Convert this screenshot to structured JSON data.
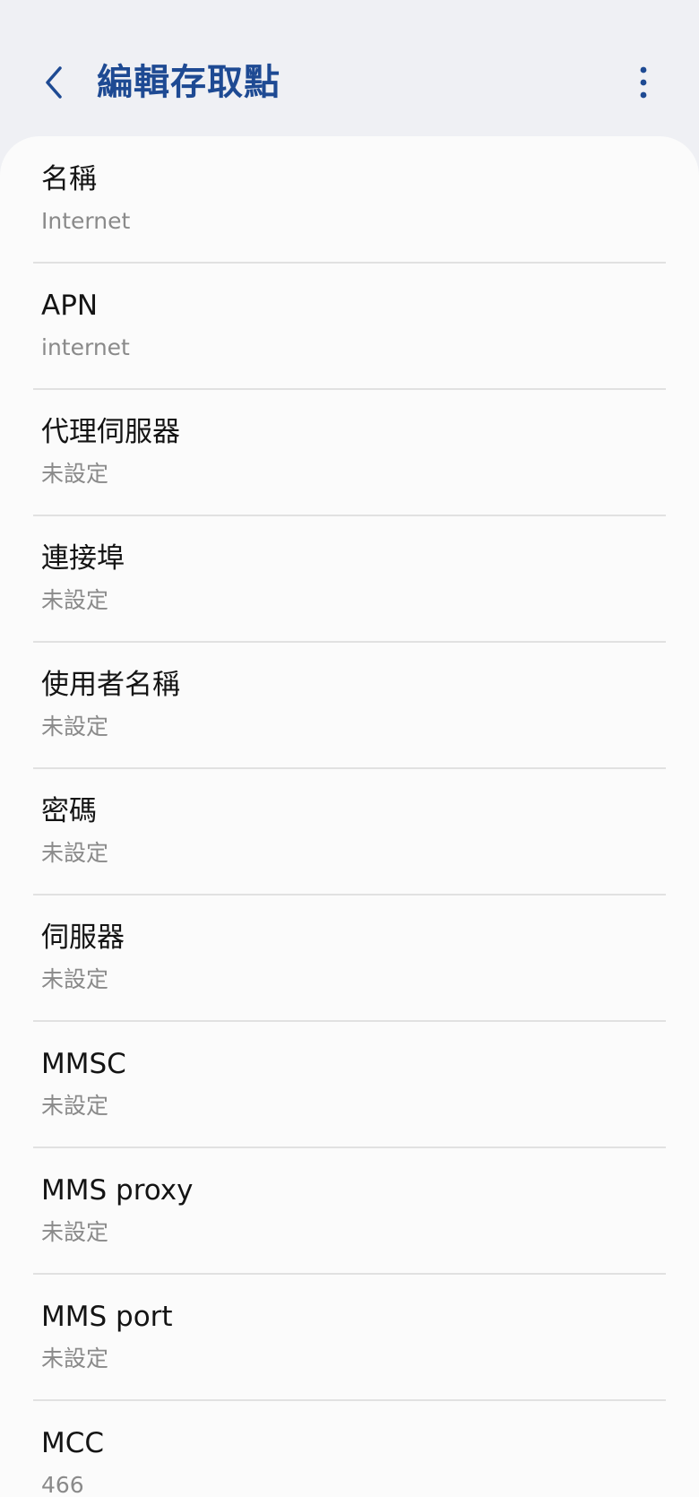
{
  "header": {
    "title": "編輯存取點",
    "back_icon": "chevron-left-icon",
    "more_icon": "more-vert-icon",
    "accent_color": "#1e4a93"
  },
  "fields": [
    {
      "label": "名稱",
      "value": "Internet"
    },
    {
      "label": "APN",
      "value": "internet"
    },
    {
      "label": "代理伺服器",
      "value": "未設定"
    },
    {
      "label": "連接埠",
      "value": "未設定"
    },
    {
      "label": "使用者名稱",
      "value": "未設定"
    },
    {
      "label": "密碼",
      "value": "未設定"
    },
    {
      "label": "伺服器",
      "value": "未設定"
    },
    {
      "label": "MMSC",
      "value": "未設定"
    },
    {
      "label": "MMS proxy",
      "value": "未設定"
    },
    {
      "label": "MMS port",
      "value": "未設定"
    },
    {
      "label": "MCC",
      "value": "466"
    }
  ]
}
